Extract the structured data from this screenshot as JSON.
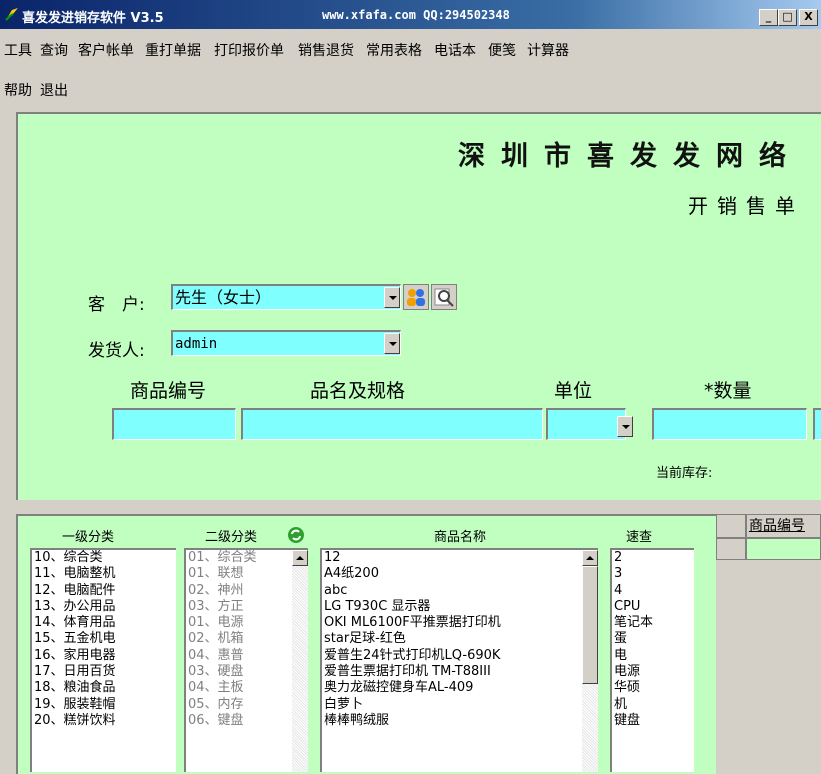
{
  "window": {
    "title": "喜发发进销存软件 V3.5",
    "website": "www.xfafa.com  QQ:294502348",
    "controls": [
      "_",
      "□",
      "X"
    ]
  },
  "menu": {
    "row1": [
      "工具",
      "查询",
      "客户帐单",
      "重打单据",
      "打印报价单",
      "销售退货",
      "常用表格",
      "电话本",
      "便笺",
      "计算器"
    ],
    "row2": [
      "帮助",
      "退出"
    ]
  },
  "form": {
    "company": "深圳市喜发发网络",
    "subtitle": "开销售单",
    "customer_label": "客　户:",
    "customer_value": "先生（女士）",
    "shipper_label": "发货人:",
    "shipper_value": "admin",
    "headers": {
      "code": "商品编号",
      "name": "品名及规格",
      "unit": "单位",
      "qty": "*数量"
    },
    "stock_label": "当前库存:"
  },
  "lists": {
    "level1_header": "一级分类",
    "level2_header": "二级分类",
    "product_header": "商品名称",
    "quick_header": "速查",
    "level1": [
      "10、综合类",
      "11、电脑整机",
      "12、电脑配件",
      "13、办公用品",
      "14、体育用品",
      "15、五金机电",
      "16、家用电器",
      "17、日用百货",
      "18、粮油食品",
      "19、服装鞋帽",
      "20、糕饼饮料"
    ],
    "level2": [
      "01、综合类",
      "01、联想",
      "02、神州",
      "03、方正",
      "01、电源",
      "02、机箱",
      "04、惠普",
      "03、硬盘",
      "04、主板",
      "05、内存",
      "06、键盘"
    ],
    "products": [
      "12",
      "A4纸200",
      "abc",
      "LG T930C  显示器",
      "OKI ML6100F平推票据打印机",
      "star足球-红色",
      "爱普生24针式打印机LQ-690K",
      "爱普生票据打印机 TM-T88III",
      "奥力龙磁控健身车AL-409",
      "白萝卜",
      "棒棒鸭绒服"
    ],
    "quick": [
      "2",
      "3",
      "4",
      "CPU",
      "笔记本",
      "蛋",
      "电",
      "电源",
      "华硕",
      "机",
      "键盘"
    ]
  },
  "grid": {
    "header": "商品编号"
  }
}
